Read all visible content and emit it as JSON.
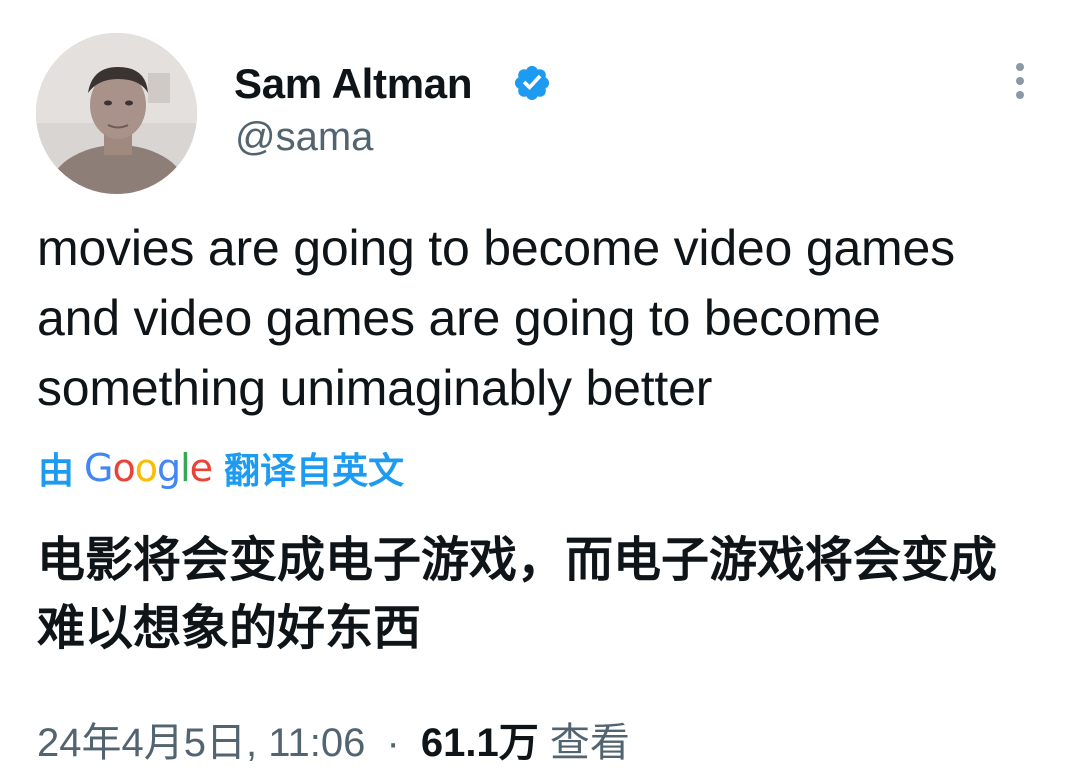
{
  "author": {
    "display_name": "Sam Altman",
    "handle": "@sama",
    "verified": true,
    "avatar_icon": "profile-photo",
    "verified_icon": "verified-badge-icon",
    "verified_color": "#1d9bf0"
  },
  "menu_icon": "more-vertical-icon",
  "tweet": {
    "text": "movies are going to become video games and video games are going to become something unimaginably better"
  },
  "translation": {
    "prefix": "由",
    "provider": "Google",
    "suffix": "翻译自英文",
    "text": "电影将会变成电子游戏，而电子游戏将会变成难以想象的好东西",
    "color": "#1d9bf0"
  },
  "meta": {
    "timestamp": "24年4月5日, 11:06",
    "separator": "·",
    "views_count": "61.1万",
    "views_label": "查看"
  }
}
